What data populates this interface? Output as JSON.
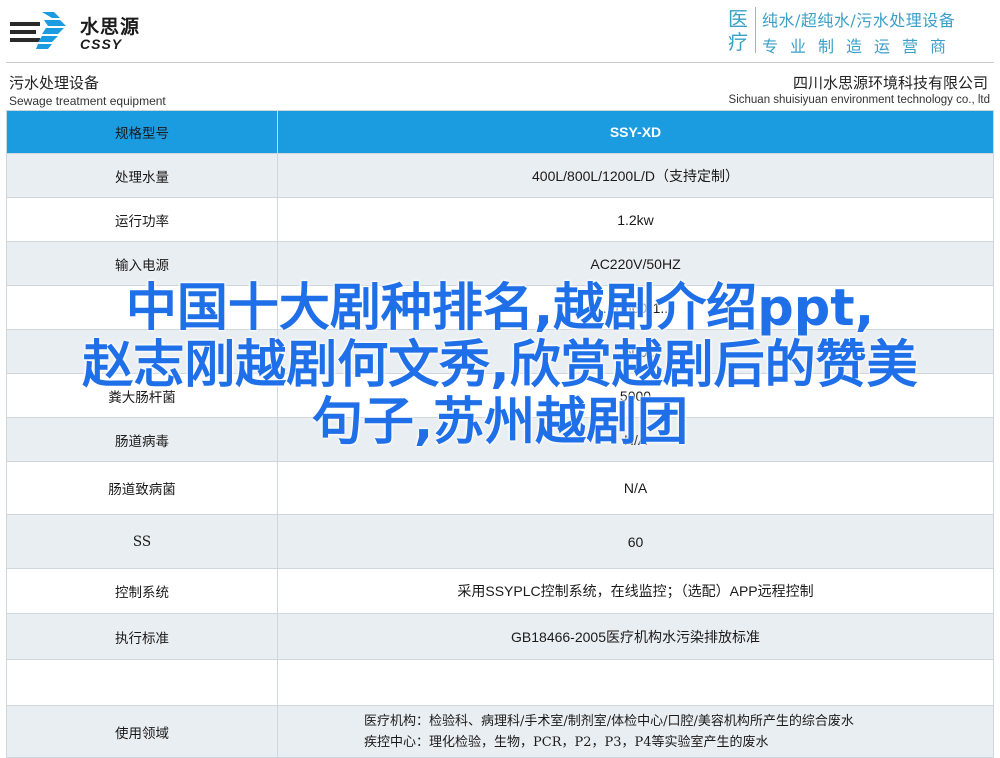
{
  "brand": {
    "logo_cn": "水思源",
    "logo_en": "CSSY",
    "badge": [
      "医",
      "疗"
    ],
    "slogan_line1": "纯水/超纯水/污水处理设备",
    "slogan_line2": "专业制造运营商",
    "accent_color": "#3aa0c8"
  },
  "header": {
    "title_cn": "污水处理设备",
    "title_en": "Sewage treatment equipment",
    "company_cn": "四川水思源环境科技有限公司",
    "company_en": "Sichuan shuisiyuan environment technology co., ltd"
  },
  "table": {
    "header_color": "#1b9be0",
    "head": {
      "key": "规格型号",
      "value": "SSY-XD"
    },
    "rows": [
      {
        "key": "处理水量",
        "value": "400L/800L/1200L/D（支持定制）"
      },
      {
        "key": "运行功率",
        "value": "1.2kw"
      },
      {
        "key": "输入电源",
        "value": "AC220V/50HZ"
      },
      {
        "key": "",
        "value": "..0*560*1.."
      },
      {
        "key": "",
        "value": "..500.."
      },
      {
        "key": "粪大肠杆菌",
        "value": "5000"
      },
      {
        "key": "肠道病毒",
        "value": "N/A"
      },
      {
        "key": "肠道致病菌",
        "value": "N/A"
      },
      {
        "key": "SS",
        "value": "60"
      },
      {
        "key": "控制系统",
        "value": "采用SSYPLC控制系统，在线监控；（选配）APP远程控制"
      },
      {
        "key": "执行标准",
        "value": "GB18466-2005医疗机构水污染排放标准"
      }
    ],
    "last_row": {
      "key": "使用领域",
      "line1": "医疗机构：检验科、病理科/手术室/制剂室/体检中心/口腔/美容机构所产生的综合废水",
      "line2": "疾控中心：理化检验，生物，PCR，P2，P3，P4等实验室产生的废水"
    }
  },
  "overlay": {
    "line1": "中国十大剧种排名,越剧介绍ppt,",
    "line2": "赵志刚越剧何文秀,欣赏越剧后的赞美",
    "line3": "句子,苏州越剧团",
    "color": "#1e6fe8"
  }
}
